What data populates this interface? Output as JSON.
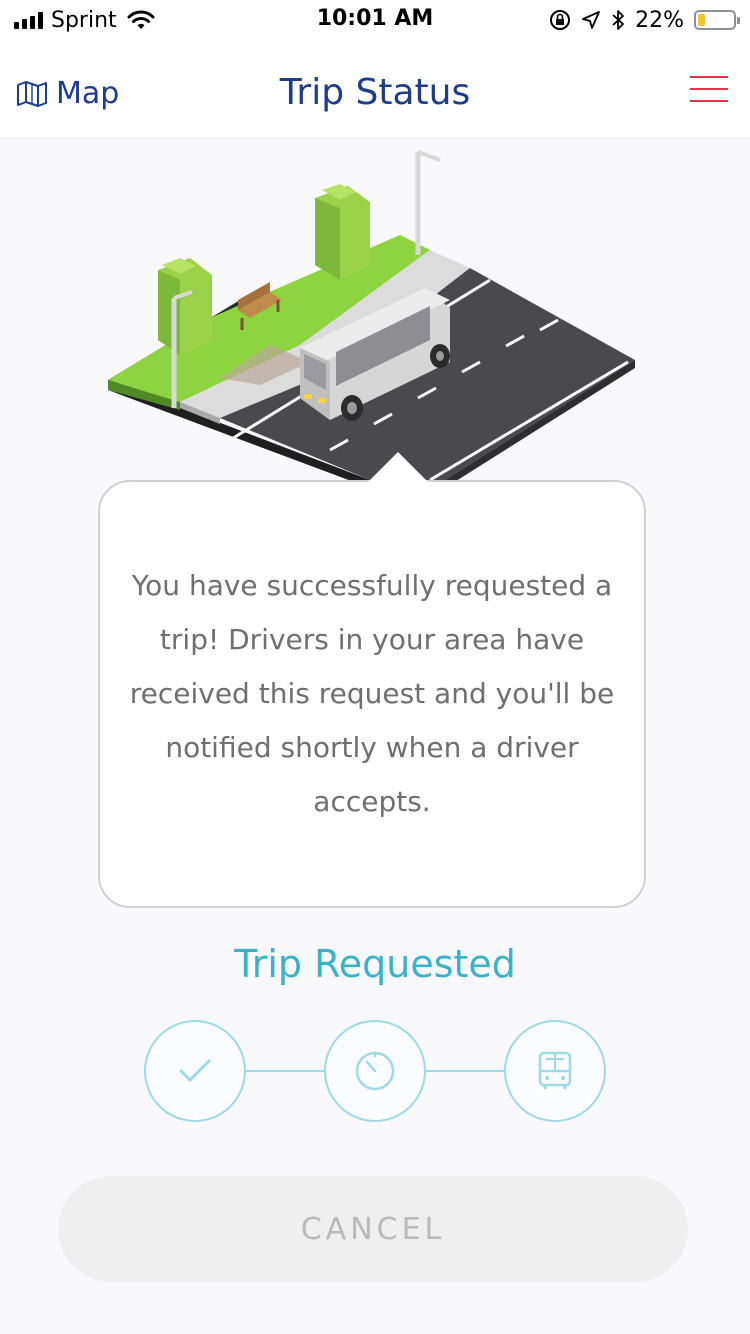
{
  "status_bar": {
    "carrier": "Sprint",
    "time": "10:01 AM",
    "battery_percent": "22%",
    "battery_level": 0.22,
    "battery_color": "#f4c430"
  },
  "nav": {
    "map_label": "Map",
    "map_icon": "map-icon",
    "title": "Trip Status",
    "menu_icon": "hamburger-menu-icon"
  },
  "message": "You have successfully requested a trip! Drivers in your area have received this request and you'll be notified shortly when a driver accepts.",
  "trip_status": "Trip Requested",
  "steps": [
    {
      "icon": "checkmark-icon"
    },
    {
      "icon": "timer-icon"
    },
    {
      "icon": "bus-icon"
    }
  ],
  "cancel_label": "CANCEL",
  "colors": {
    "brand_blue": "#1d3c8c",
    "accent_teal": "#3ab3c9",
    "menu_red": "#e0344a"
  }
}
